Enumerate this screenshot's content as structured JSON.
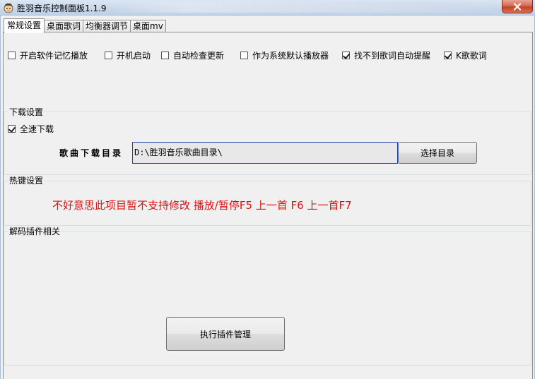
{
  "window": {
    "title": "胜羽音乐控制面板1.1.9",
    "icon": "mascot-avatar-icon",
    "close_icon": "close-icon"
  },
  "tabs": [
    {
      "label": "常规设置",
      "active": true
    },
    {
      "label": "桌面歌词",
      "active": false
    },
    {
      "label": "均衡器调节",
      "active": false
    },
    {
      "label": "桌面mv",
      "active": false
    }
  ],
  "general": {
    "options": [
      {
        "label": "开启软件记忆播放",
        "checked": false
      },
      {
        "label": "开机启动",
        "checked": false
      },
      {
        "label": "自动检查更新",
        "checked": false
      },
      {
        "label": "作为系统默认播放器",
        "checked": false
      },
      {
        "label": "找不到歌词自动提醒",
        "checked": true
      },
      {
        "label": "K歌歌词",
        "checked": true
      }
    ]
  },
  "download": {
    "title": "下载设置",
    "full_speed": {
      "label": "全速下载",
      "checked": true
    },
    "dir_label": "歌曲下载目录",
    "dir_value": "D:\\胜羽音乐歌曲目录\\",
    "choose_button": "选择目录"
  },
  "hotkeys": {
    "title": "热键设置",
    "message": "不好意思此项目暂不支持修改  播放/暂停F5 上一首 F6 上一首F7"
  },
  "decoder": {
    "title": "解码插件相关",
    "run_button": "执行插件管理"
  },
  "colors": {
    "hotkey_message": "#e01010",
    "input_border": "#2244aa",
    "close_button": "#c2432a"
  }
}
